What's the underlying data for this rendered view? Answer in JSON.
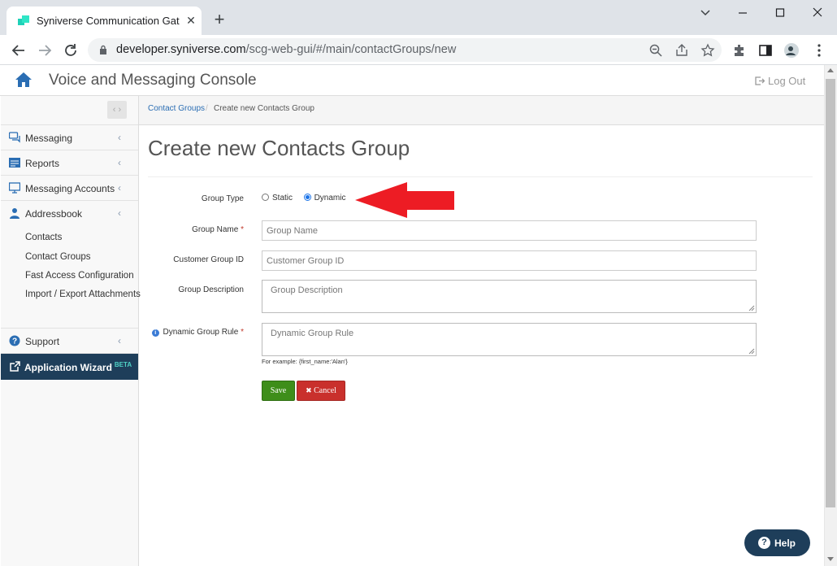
{
  "browser": {
    "tab_title": "Syniverse Communication Gateway",
    "url_host": "developer.syniverse.com",
    "url_path": "/scg-web-gui/#/main/contactGroups/new"
  },
  "app": {
    "title": "Voice and Messaging Console",
    "logout_label": "Log Out"
  },
  "sidebar": {
    "items": [
      {
        "label": "Messaging"
      },
      {
        "label": "Reports"
      },
      {
        "label": "Messaging Accounts"
      },
      {
        "label": "Addressbook"
      }
    ],
    "addressbook_sub": [
      "Contacts",
      "Contact Groups",
      "Fast Access Configuration",
      "Import / Export Attachments"
    ],
    "support_label": "Support",
    "wizard_label": "Application Wizard",
    "wizard_badge": "BETA"
  },
  "breadcrumb": {
    "parent": "Contact Groups",
    "separator": "/",
    "current": "Create new Contacts Group"
  },
  "form": {
    "page_title": "Create new Contacts Group",
    "group_type_label": "Group Type",
    "group_type_options": [
      "Static",
      "Dynamic"
    ],
    "group_type_selected": "Dynamic",
    "group_name_label": "Group Name",
    "group_name_placeholder": "Group Name",
    "customer_group_id_label": "Customer Group ID",
    "customer_group_id_placeholder": "Customer Group ID",
    "group_description_label": "Group Description",
    "group_description_placeholder": "Group Description",
    "dynamic_rule_label": "Dynamic Group Rule",
    "dynamic_rule_placeholder": "Dynamic Group Rule",
    "required_marker": "*",
    "info_marker": "i",
    "dynamic_rule_hint": "For example: {first_name:'Alan'}",
    "save_label": "Save",
    "cancel_label": "Cancel"
  },
  "help_label": "Help",
  "colors": {
    "accent_blue": "#2a6db3",
    "sidebar_dark": "#1e3e5a",
    "save_green": "#3e8e1a",
    "cancel_red": "#c9302c",
    "arrow_red": "#ed1c24"
  }
}
